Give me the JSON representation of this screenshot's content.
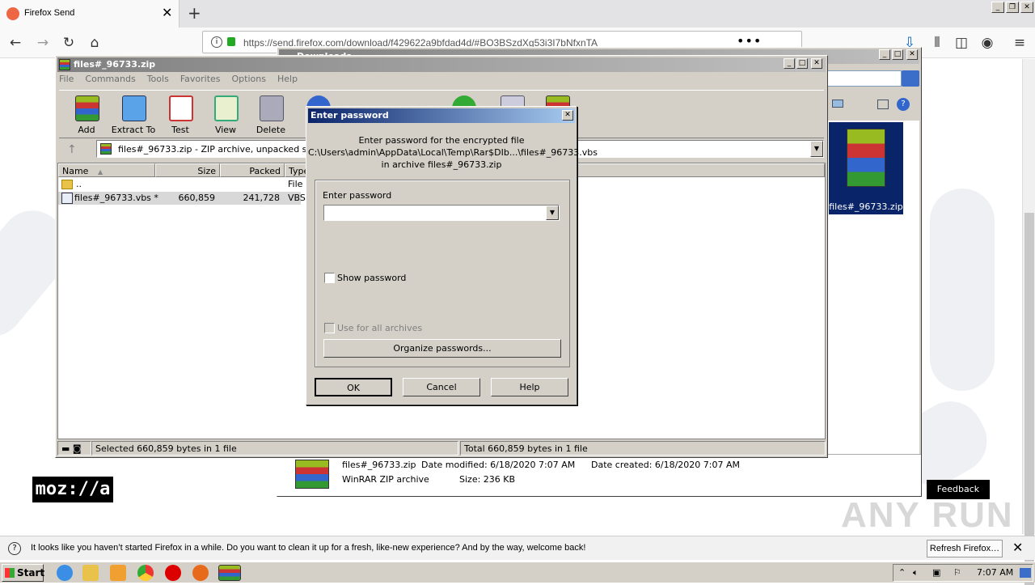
{
  "browser": {
    "tab_title": "Firefox Send",
    "url": "https://send.firefox.com/download/f429622a9bfdad4d/#BO3BSzdXg53i3I7bNfxnTA",
    "new_tab": "+",
    "close_tab": "✕"
  },
  "page": {
    "brand": "moz://a",
    "feedback": "Feedback",
    "watermark": "ANY RUN"
  },
  "notification": {
    "text": "It looks like you haven’t started Firefox in a while. Do you want to clean it up for a fresh, like-new experience? And by the way, welcome back!",
    "button": "Refresh Firefox…"
  },
  "taskbar": {
    "start": "Start",
    "clock": "7:07 AM"
  },
  "explorer": {
    "title": "Downloads",
    "selected_label": "files#_96733.zip",
    "file_name": "files#_96733.zip",
    "file_type": "WinRAR ZIP archive",
    "date_modified": "Date modified: 6/18/2020 7:07 AM",
    "date_created": "Date created: 6/18/2020 7:07 AM",
    "size": "Size: 236 KB"
  },
  "winrar": {
    "title": "files#_96733.zip",
    "menu": [
      "File",
      "Commands",
      "Tools",
      "Favorites",
      "Options",
      "Help"
    ],
    "toolbar": [
      "Add",
      "Extract To",
      "Test",
      "View",
      "Delete"
    ],
    "path": "files#_96733.zip - ZIP archive, unpacked size 66",
    "columns": [
      "Name",
      "Size",
      "Packed",
      "Type"
    ],
    "rows": [
      {
        "name": "..",
        "size": "",
        "packed": "",
        "type": "File I"
      },
      {
        "name": "files#_96733.vbs *",
        "size": "660,859",
        "packed": "241,728",
        "type": "VBSc"
      }
    ],
    "status_left": "Selected 660,859 bytes in 1 file",
    "status_right": "Total 660,859 bytes in 1 file"
  },
  "dialog": {
    "title": "Enter password",
    "line1": "Enter password for the encrypted file",
    "line2": "C:\\Users\\admin\\AppData\\Local\\Temp\\Rar$DIb...\\files#_96733.vbs",
    "line3": "in archive files#_96733.zip",
    "field_label": "Enter password",
    "field_value": "",
    "show_password": "Show password",
    "use_all": "Use for all archives",
    "organize": "Organize passwords...",
    "ok": "OK",
    "cancel": "Cancel",
    "help": "Help"
  }
}
